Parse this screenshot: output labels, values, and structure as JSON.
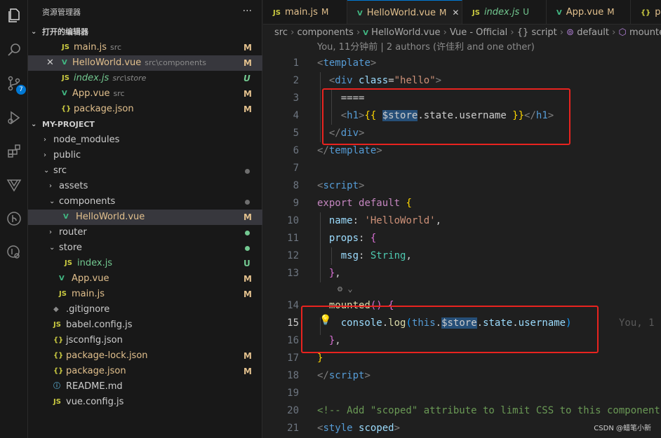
{
  "activity_bar": {
    "items": [
      {
        "name": "explorer-icon"
      },
      {
        "name": "search-icon"
      },
      {
        "name": "source-control-icon",
        "badge": "7"
      },
      {
        "name": "run-debug-icon"
      },
      {
        "name": "extensions-icon"
      },
      {
        "name": "vue-devtools-icon"
      },
      {
        "name": "git-graph-icon"
      },
      {
        "name": "remote-icon"
      }
    ]
  },
  "sidebar": {
    "title": "资源管理器",
    "more": "···",
    "open_editors": {
      "label": "打开的编辑器",
      "items": [
        {
          "icon": "JS",
          "name": "main.js",
          "desc": "src",
          "status": "M"
        },
        {
          "icon": "V",
          "name": "HelloWorld.vue",
          "desc": "src\\components",
          "status": "M",
          "close": "✕"
        },
        {
          "icon": "JS",
          "name": "index.js",
          "desc": "src\\store",
          "status": "U"
        },
        {
          "icon": "V",
          "name": "App.vue",
          "desc": "src",
          "status": "M"
        },
        {
          "icon": "{}",
          "name": "package.json",
          "desc": "",
          "status": "M"
        }
      ]
    },
    "project": {
      "label": "MY-PROJECT",
      "items": [
        {
          "twisty": "›",
          "icon": "",
          "name": "node_modules",
          "status": ""
        },
        {
          "twisty": "›",
          "icon": "",
          "name": "public",
          "status": ""
        },
        {
          "twisty": "⌄",
          "icon": "",
          "name": "src",
          "status": ""
        },
        {
          "twisty": "›",
          "icon": "",
          "name": "assets",
          "status": ""
        },
        {
          "twisty": "⌄",
          "icon": "",
          "name": "components",
          "status": ""
        },
        {
          "twisty": "",
          "icon": "V",
          "name": "HelloWorld.vue",
          "status": "M"
        },
        {
          "twisty": "›",
          "icon": "",
          "name": "router",
          "status": ""
        },
        {
          "twisty": "⌄",
          "icon": "",
          "name": "store",
          "status": ""
        },
        {
          "twisty": "",
          "icon": "JS",
          "name": "index.js",
          "status": "U"
        },
        {
          "twisty": "",
          "icon": "V",
          "name": "App.vue",
          "status": "M"
        },
        {
          "twisty": "",
          "icon": "JS",
          "name": "main.js",
          "status": "M"
        },
        {
          "twisty": "",
          "icon": "◆",
          "name": ".gitignore",
          "status": ""
        },
        {
          "twisty": "",
          "icon": "JS",
          "name": "babel.config.js",
          "status": ""
        },
        {
          "twisty": "",
          "icon": "{}",
          "name": "jsconfig.json",
          "status": ""
        },
        {
          "twisty": "",
          "icon": "{}",
          "name": "package-lock.json",
          "status": "M"
        },
        {
          "twisty": "",
          "icon": "{}",
          "name": "package.json",
          "status": "M"
        },
        {
          "twisty": "",
          "icon": "ⓘ",
          "name": "README.md",
          "status": ""
        },
        {
          "twisty": "",
          "icon": "JS",
          "name": "vue.config.js",
          "status": ""
        }
      ]
    }
  },
  "tabs": [
    {
      "icon": "JS",
      "name": "main.js",
      "status": "M"
    },
    {
      "icon": "V",
      "name": "HelloWorld.vue",
      "status": "M",
      "close": "✕"
    },
    {
      "icon": "JS",
      "name": "index.js",
      "status": "U"
    },
    {
      "icon": "V",
      "name": "App.vue",
      "status": "M"
    },
    {
      "icon": "{}",
      "name": "p",
      "status": ""
    }
  ],
  "breadcrumbs": [
    "src",
    "components",
    "HelloWorld.vue",
    "Vue - Official",
    "{} script",
    "default",
    "mounted"
  ],
  "blame": "You, 11分钟前 | 2 authors (许佳利 and one other)",
  "editor": {
    "line_numbers": [
      "1",
      "2",
      "3",
      "4",
      "5",
      "6",
      "7",
      "8",
      "9",
      "10",
      "11",
      "12",
      "13",
      "14",
      "15",
      "16",
      "17",
      "18",
      "19",
      "20",
      "21"
    ],
    "current_line": "15",
    "codelens": "⚙ ⌄",
    "inline_blame": "You, 1",
    "lightbulb": "💡"
  },
  "watermark": "CSDN @蜡笔小新"
}
